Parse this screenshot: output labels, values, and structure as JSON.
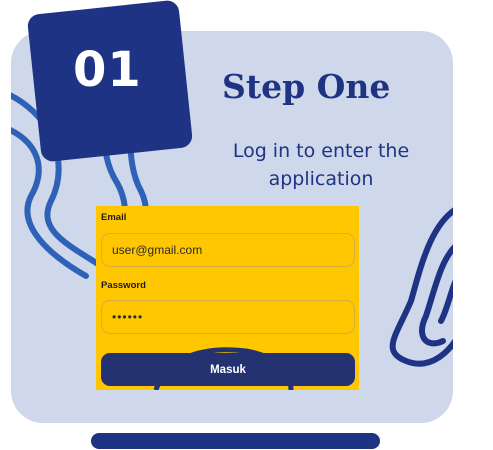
{
  "step": {
    "number": "01",
    "title": "Step One",
    "description": "Log in to enter the application"
  },
  "login": {
    "email_label": "Email",
    "email_value": "user@gmail.com",
    "password_label": "Password",
    "password_value": "••••••",
    "submit_label": "Masuk"
  },
  "colors": {
    "card_bg": "#cfd8ea",
    "brand_navy": "#1f3384",
    "panel_yellow": "#fec700",
    "squiggle_blue": "#2e62b8"
  }
}
